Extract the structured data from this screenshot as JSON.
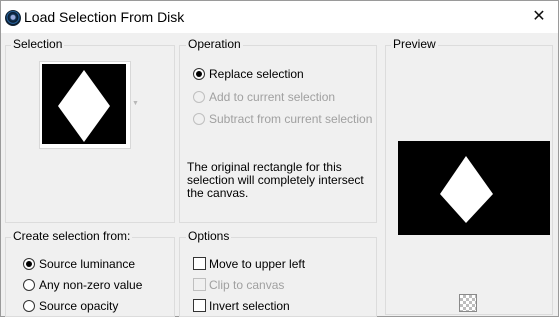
{
  "window": {
    "title": "Load Selection From Disk",
    "close_glyph": "✕",
    "icon": "app-icon"
  },
  "selection_group": {
    "label": "Selection",
    "dropdown_glyph": "▼"
  },
  "operation_group": {
    "label": "Operation",
    "options": [
      {
        "label": "Replace selection",
        "selected": true,
        "enabled": true
      },
      {
        "label": "Add to current selection",
        "selected": false,
        "enabled": false
      },
      {
        "label": "Subtract from current selection",
        "selected": false,
        "enabled": false
      }
    ],
    "info_text": "The original rectangle for this selection will completely intersect the canvas."
  },
  "preview_group": {
    "label": "Preview",
    "transparency_icon": "checkerboard-icon"
  },
  "create_group": {
    "label": "Create selection from:",
    "options": [
      {
        "label": "Source luminance",
        "selected": true
      },
      {
        "label": "Any non-zero value",
        "selected": false
      },
      {
        "label": "Source opacity",
        "selected": false
      }
    ]
  },
  "options_group": {
    "label": "Options",
    "checks": [
      {
        "label": "Move to upper left",
        "checked": false,
        "enabled": true
      },
      {
        "label": "Clip to canvas",
        "checked": false,
        "enabled": false
      },
      {
        "label": "Invert selection",
        "checked": false,
        "enabled": true
      }
    ]
  },
  "colors": {
    "canvas": "#000000",
    "shape": "#ffffff",
    "disabled_text": "#a0a0a0"
  }
}
